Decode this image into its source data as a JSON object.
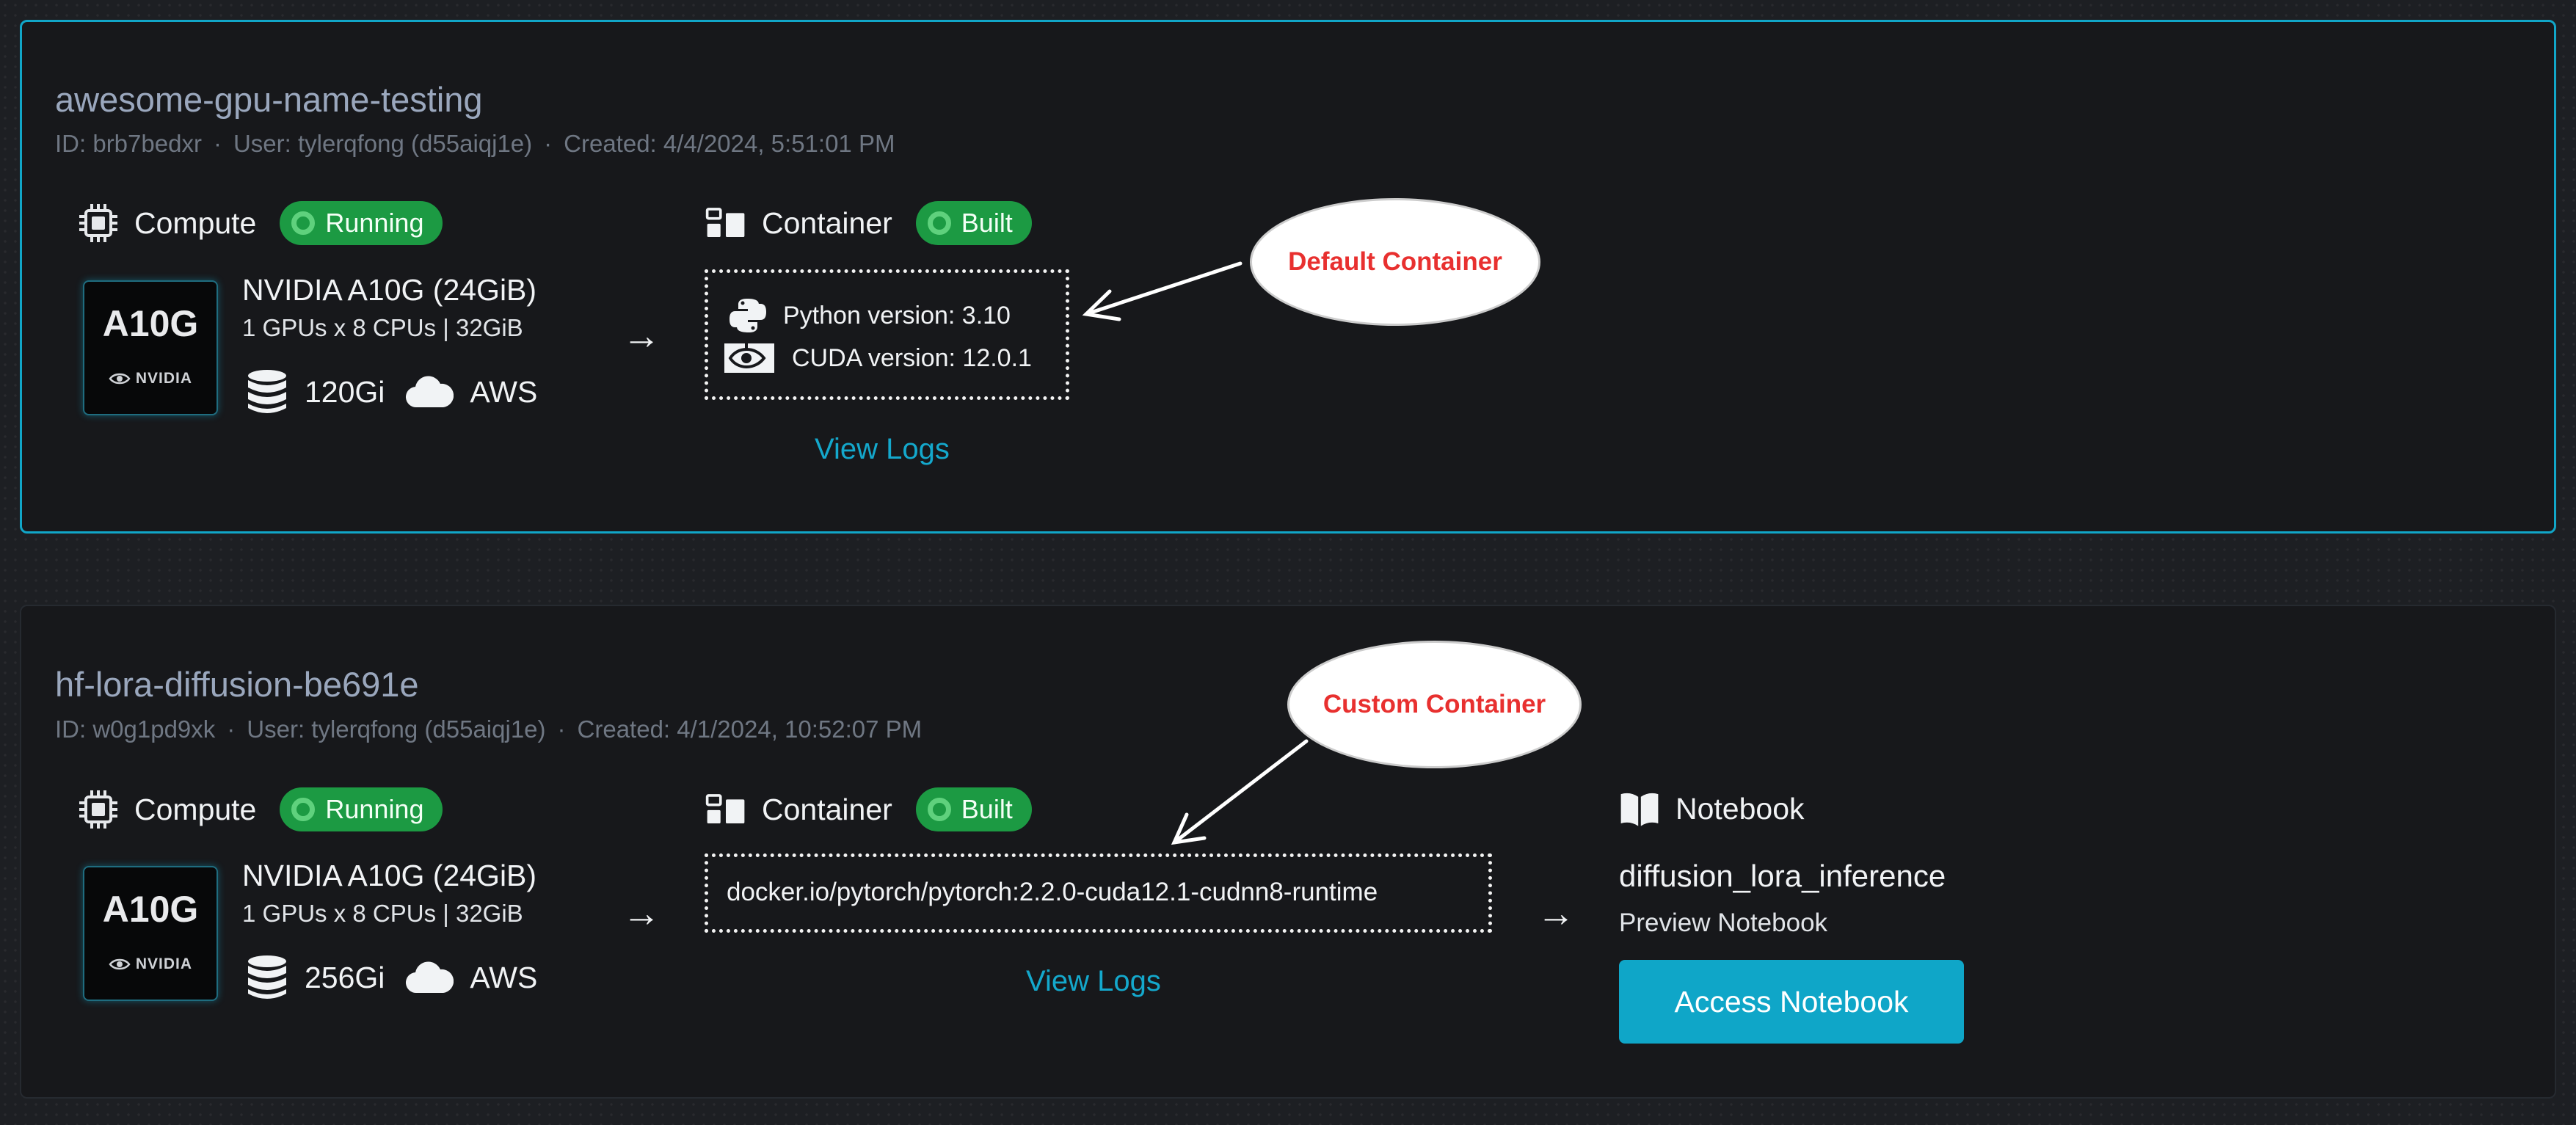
{
  "deployments": [
    {
      "name": "awesome-gpu-name-testing",
      "id": "ID: brb7bedxr",
      "user": "User:  tylerqfong (d55aiqj1e)",
      "created": "Created: 4/4/2024, 5:51:01 PM",
      "compute": {
        "label": "Compute",
        "status": "Running",
        "chip_model": "A10G",
        "chip_brand": "NVIDIA",
        "gpu_name": "NVIDIA A10G (24GiB)",
        "gpu_spec": "1 GPUs x 8 CPUs | 32GiB",
        "storage": "120Gi",
        "cloud": "AWS"
      },
      "container": {
        "label": "Container",
        "status": "Built",
        "python_version": "Python version: 3.10",
        "cuda_version": "CUDA version: 12.0.1",
        "view_logs": "View Logs"
      },
      "callout": "Default Container"
    },
    {
      "name": "hf-lora-diffusion-be691e",
      "id": "ID: w0g1pd9xk",
      "user": "User:  tylerqfong (d55aiqj1e)",
      "created": "Created: 4/1/2024, 10:52:07 PM",
      "compute": {
        "label": "Compute",
        "status": "Running",
        "chip_model": "A10G",
        "chip_brand": "NVIDIA",
        "gpu_name": "NVIDIA A10G (24GiB)",
        "gpu_spec": "1 GPUs x 8 CPUs | 32GiB",
        "storage": "256Gi",
        "cloud": "AWS"
      },
      "container": {
        "label": "Container",
        "status": "Built",
        "image": "docker.io/pytorch/pytorch:2.2.0-cuda12.1-cudnn8-runtime",
        "view_logs": "View Logs"
      },
      "notebook": {
        "label": "Notebook",
        "name": "diffusion_lora_inference",
        "preview": "Preview Notebook",
        "access_button": "Access Notebook"
      },
      "callout": "Custom Container"
    }
  ],
  "icons": {
    "compute": "cpu-chip-icon",
    "container": "container-blocks-icon",
    "storage": "database-icon",
    "cloud": "cloud-icon",
    "python": "python-logo-icon",
    "cuda": "nvidia-logo-icon",
    "notebook": "open-book-icon",
    "arrow": "arrow-right-icon"
  },
  "colors": {
    "accent": "#11a6c8",
    "status_green": "#1c9a43",
    "callout_text": "#e8302f"
  }
}
